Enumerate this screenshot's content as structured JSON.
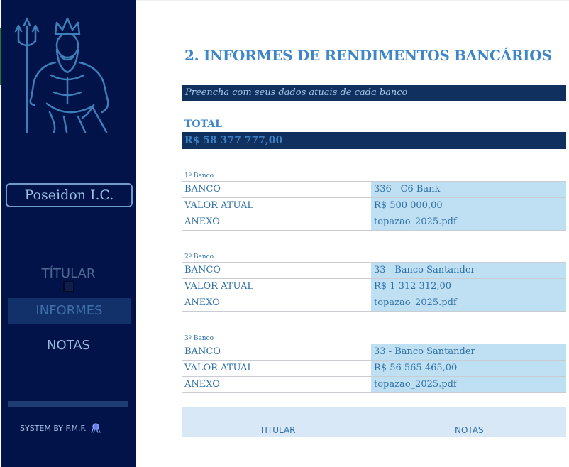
{
  "sidebar": {
    "brand": "Poseidon I.C.",
    "nav": {
      "titular": "TÍTULAR",
      "informes": "INFORMES",
      "notas": "NOTAS"
    },
    "credit": "SYSTEM BY F.M.F.",
    "logo_icon": "poseidon-trident-icon",
    "credit_icon": "octopus-icon"
  },
  "main": {
    "title": "2. INFORMES DE RENDIMENTOS BANCÁRIOS",
    "subtitle": "Preencha com seus dados atuais de cada banco",
    "total_label": "TOTAL",
    "total_value": "R$ 58 377 777,00",
    "banks": [
      {
        "heading": "1º Banco",
        "rows": [
          {
            "label": "BANCO",
            "value": "336 - C6 Bank"
          },
          {
            "label": "VALOR ATUAL",
            "value": "R$ 500 000,00"
          },
          {
            "label": "ANEXO",
            "value": "topazao_2025.pdf"
          }
        ]
      },
      {
        "heading": "2º Banco",
        "rows": [
          {
            "label": "BANCO",
            "value": "33 - Banco Santander"
          },
          {
            "label": "VALOR ATUAL",
            "value": "R$ 1 312 312,00"
          },
          {
            "label": "ANEXO",
            "value": "topazao_2025.pdf"
          }
        ]
      },
      {
        "heading": "3º Banco",
        "rows": [
          {
            "label": "BANCO",
            "value": "33 - Banco Santander"
          },
          {
            "label": "VALOR ATUAL",
            "value": "R$ 56 565 465,00"
          },
          {
            "label": "ANEXO",
            "value": "topazao_2025.pdf"
          }
        ]
      }
    ],
    "footer": {
      "link_titular": "TITULAR",
      "link_notas": "NOTAS"
    }
  },
  "colors": {
    "sidebar_bg": "#021349",
    "accent": "#3e86c5",
    "dark_bar": "#10305f",
    "value_cell": "#bfe0f2"
  }
}
